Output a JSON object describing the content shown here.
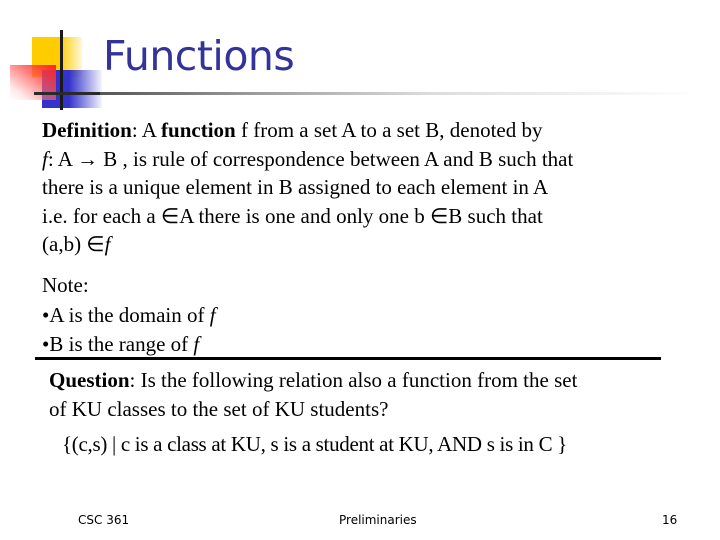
{
  "slide": {
    "title": "Functions",
    "definition": {
      "line1": {
        "label": "Definition",
        "sep": ": A ",
        "term": "function",
        "rest": " f from a set A to a set B, denoted by"
      },
      "line2": {
        "f": "f",
        "mid": ": A ",
        "arrow": "→",
        "rest": " B , is rule of correspondence between A and B  such that"
      },
      "line3": "there is a unique element in B assigned to each element in A",
      "line4": "i.e. for each a ∈A there is one and only one b ∈B such that",
      "line5": {
        "pre": "(a,b) ∈",
        "f": "f"
      }
    },
    "note": {
      "heading": "Note:",
      "items": [
        {
          "bullet": "•",
          "text": "A is the domain of ",
          "f": "f"
        },
        {
          "bullet": "•",
          "text": "B is the range of ",
          "f": "f"
        }
      ]
    },
    "question": {
      "label": "Question",
      "line1_rest": ": Is the following relation also a function from the set",
      "line2": "of KU classes to the set of KU students?"
    },
    "relation": "{(c,s) | c is a class at KU, s is a student at KU, AND s is in C }",
    "footer": {
      "course": "CSC 361",
      "topic": "Preliminaries",
      "page_number": "16"
    },
    "colors": {
      "title": "#333399",
      "deco_yellow": "#ffcc00",
      "deco_blue": "#3333cc",
      "deco_red": "#ff2020"
    }
  }
}
